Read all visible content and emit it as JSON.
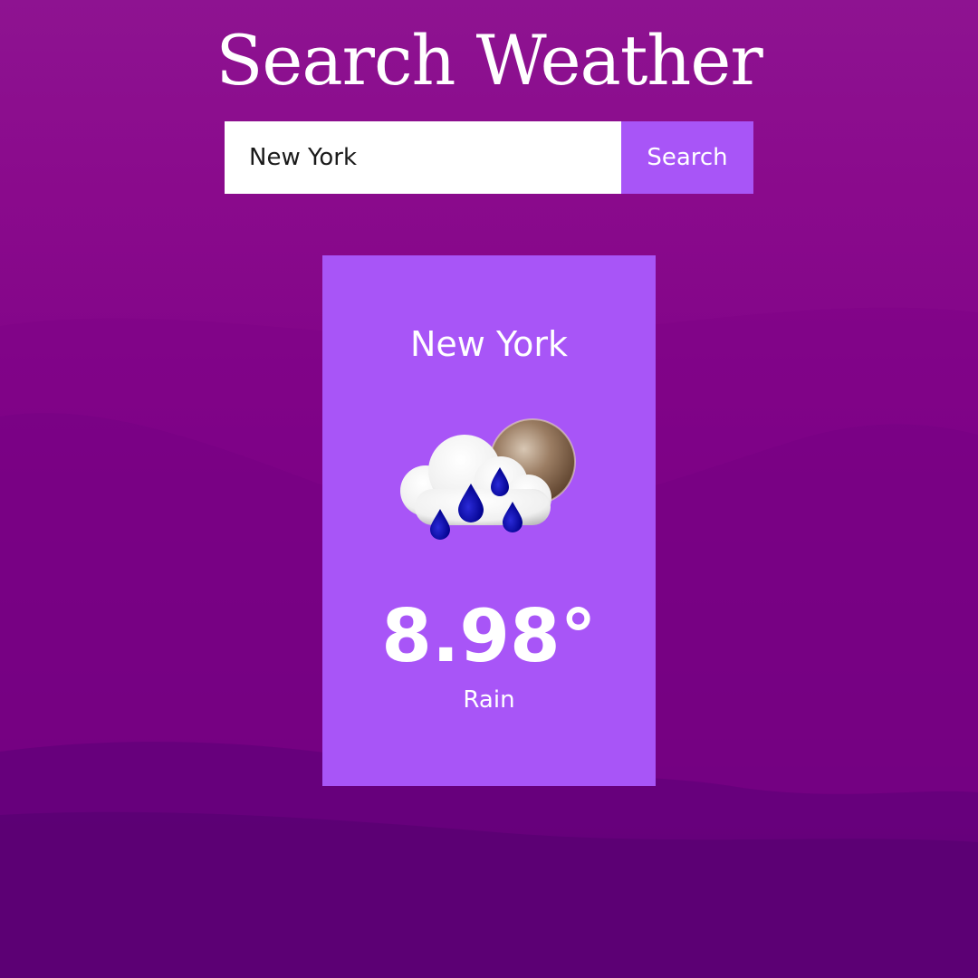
{
  "header": {
    "title": "Search Weather"
  },
  "search": {
    "value": "New York",
    "button_label": "Search"
  },
  "weather": {
    "city": "New York",
    "temperature": "8.98°",
    "condition": "Rain",
    "icon": "rain-cloud-moon-icon"
  },
  "colors": {
    "accent": "#a855f7",
    "background_top": "#8e1391",
    "background_bottom": "#56006f",
    "text": "#ffffff"
  }
}
